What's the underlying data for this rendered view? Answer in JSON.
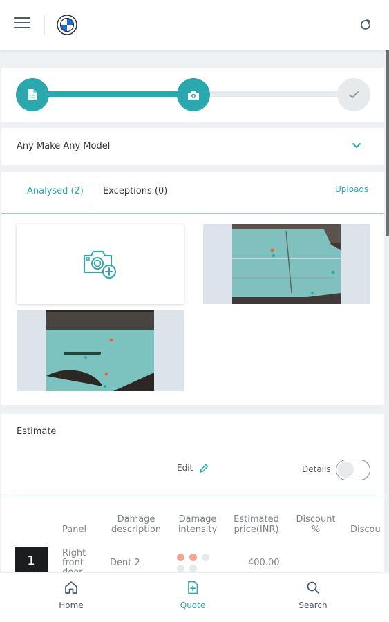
{
  "header": {
    "menu_icon": "hamburger-icon",
    "logo": "bmw-logo",
    "refresh_icon": "refresh-icon"
  },
  "stepper": {
    "steps": [
      {
        "icon": "document-icon",
        "state": "complete"
      },
      {
        "icon": "camera-icon",
        "state": "active"
      },
      {
        "icon": "check-icon",
        "state": "pending"
      }
    ]
  },
  "vehicle": {
    "selected": "Any Make Any Model"
  },
  "gallery": {
    "tabs": [
      {
        "label": "Analysed (2)"
      },
      {
        "label": "Exceptions (0)"
      }
    ],
    "uploads_label": "Uploads",
    "add_photo_icon": "camera-add-icon"
  },
  "estimate": {
    "title": "Estimate",
    "edit_label": "Edit",
    "details_label": "Details",
    "details_on": false,
    "columns": [
      "Panel",
      "Damage description",
      "Damage intensity",
      "Estimated price(INR)",
      "Discount %",
      "Discou"
    ],
    "rows": [
      {
        "index": "1",
        "panel": "Right front door",
        "description": "Dent 2",
        "intensity": 2,
        "intensity_max": 4,
        "price": "400.00"
      }
    ]
  },
  "nav": {
    "items": [
      {
        "label": "Home",
        "icon": "home-icon"
      },
      {
        "label": "Quote",
        "icon": "quote-icon"
      },
      {
        "label": "Search",
        "icon": "search-icon"
      }
    ]
  },
  "colors": {
    "accent": "#2aa8ae",
    "damage": "#f4a58f",
    "inactive": "#e7eaec"
  }
}
